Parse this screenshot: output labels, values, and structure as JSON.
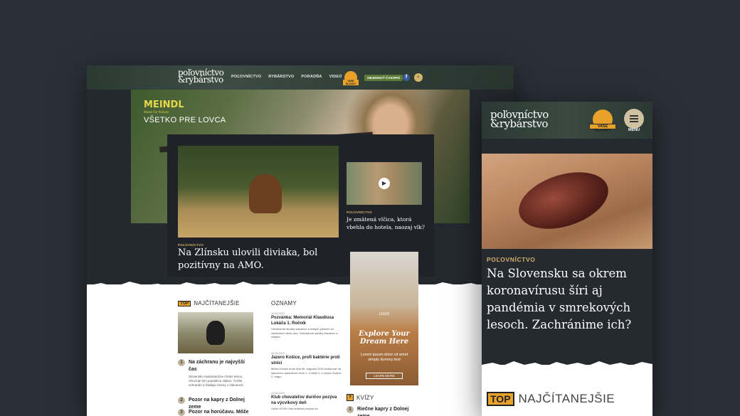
{
  "desktop": {
    "logo": {
      "line1": "poľovníctvo",
      "line2": "&rybárstvo"
    },
    "nav": [
      "POĽOVNÍCTVO",
      "RYBÁRSTVO",
      "PORADŇA",
      "VIDEO"
    ],
    "badge_label": "VAŠE ÚLOVKY",
    "subscribe_label": "OBJEDNAŤ ČASOPIS",
    "fb_label": "f",
    "search_label": "⌕",
    "hero": {
      "brand": "MEINDL",
      "brand_sub": "Shoes For Actives",
      "title": "VŠETKO PRE LOVCA"
    },
    "feature": {
      "category": "POĽOVNÍCTVO",
      "title": "Na Zlínsku ulovili diviaka, bol pozitívny na AMO."
    },
    "side_story": {
      "category": "POĽOVNÍCTVO",
      "title": "Je zmätená vlčica, ktorá vbehla do hotela, naozaj vlk?"
    },
    "ad": {
      "logo": "LOGO",
      "title": "Explore Your Dream Here",
      "body": "Lorem ipsum dolor sit amet simply dummy text",
      "button": "LEARN MORE"
    },
    "top_section": {
      "tag": "TOP",
      "title": "NAJČÍTANEJŠIE"
    },
    "top_items": [
      {
        "num": "1",
        "title": "Na záchranu je najvyšší čas",
        "desc": "Slovensko nedostatočne chráni tetrov, ohrozuje tým populáciu vtákov. Tvrdia ochranári a žiadajú zmeny v zákonoch."
      },
      {
        "num": "2",
        "title": "Pozor na kapry z Dolnej zeme",
        "desc": ""
      },
      {
        "num": "3",
        "title": "Pozor na horúčavu. Môže mať",
        "desc": ""
      }
    ],
    "announcements_title": "OZNAMY",
    "announcements": [
      {
        "date": "10.06.2019",
        "title": "Pozvánka: Memoriál Klaudiusa Lukáča 1. Ročník",
        "desc": "Všestranné skúšky stavačov a malých plemien so zadávaním titulu cact. Všestranné skúšky stavačov a malých"
      },
      {
        "date": "04.06.2019",
        "title": "Jazero Košice, profi baktérie proti sinici",
        "desc": "Mesto Košice bude dňa 06. augusta 2018 realizovať na kaprovom rybárskom revíri č. 4-0840-1-1 Jazero Košice 2. etapu"
      },
      {
        "date": "22.06.2019",
        "title": "Klub chovateľov duričov pozýva na výcvikový deň",
        "desc": "Výbor KCHD Vás srdečne pozýva na"
      }
    ],
    "quiz_section": {
      "icon": "?",
      "title": "KVÍZY"
    },
    "quiz_items": [
      {
        "num": "1",
        "title": "Riečne kapry z Dolnej zeme"
      }
    ]
  },
  "mobile": {
    "logo": {
      "line1": "poľovníctvo",
      "line2": "&rybárstvo"
    },
    "badge_label": "VAŠE ÚLOVKY",
    "menu_label": "MENU",
    "category": "POĽOVNÍCTVO",
    "title": "Na Slovensku sa okrem koronavírusu šíri aj pandémia v smrekových lesoch. Zachránime ich?",
    "top_section": {
      "tag": "TOP",
      "title": "NAJČÍTANEJŠIE"
    }
  }
}
